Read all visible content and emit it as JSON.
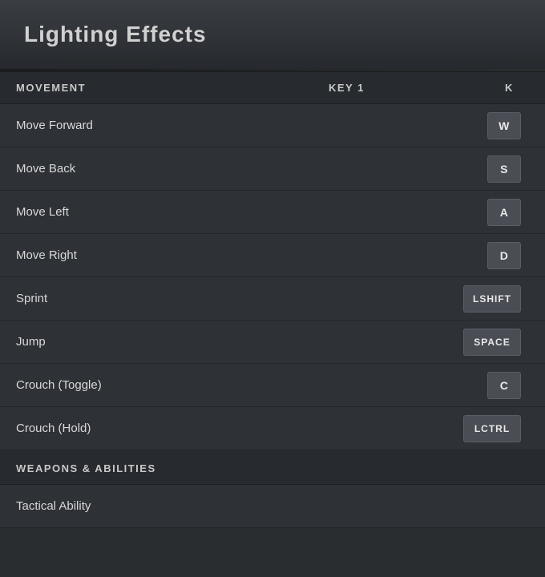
{
  "header": {
    "title": "Lighting Effects"
  },
  "table": {
    "col_action": "MOVEMENT",
    "col_key1": "KEY 1",
    "col_key2": "K"
  },
  "movement": {
    "section_label": "MOVEMENT",
    "rows": [
      {
        "action": "Move Forward",
        "key1": "W",
        "wide": false
      },
      {
        "action": "Move Back",
        "key1": "S",
        "wide": false
      },
      {
        "action": "Move Left",
        "key1": "A",
        "wide": false
      },
      {
        "action": "Move Right",
        "key1": "D",
        "wide": false
      },
      {
        "action": "Sprint",
        "key1": "LSHIFT",
        "wide": true
      },
      {
        "action": "Jump",
        "key1": "SPACE",
        "wide": true
      },
      {
        "action": "Crouch (Toggle)",
        "key1": "C",
        "wide": false
      },
      {
        "action": "Crouch (Hold)",
        "key1": "LCTRL",
        "wide": true
      }
    ]
  },
  "weapons": {
    "section_label": "WEAPONS & ABILITIES",
    "rows": [
      {
        "action": "Tactical Ability",
        "key1": "",
        "wide": false
      }
    ]
  }
}
